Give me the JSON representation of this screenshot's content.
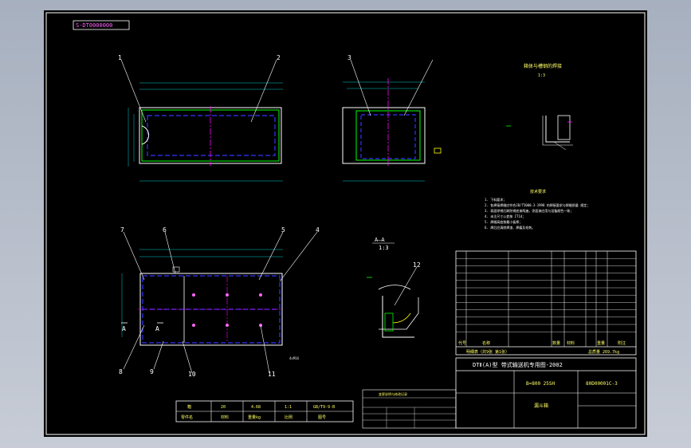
{
  "drawing": {
    "code_box": "S-DT0000000",
    "colors": {
      "sheet": "#000000",
      "outline": "#ffffff",
      "part": "#00ff00",
      "hidden": "#3333ff",
      "dim": "#00cccc",
      "center": "#ff00ff",
      "text": "#ffff00"
    }
  },
  "callouts": [
    "1",
    "2",
    "3",
    "4",
    "5",
    "6",
    "7",
    "8",
    "9",
    "10",
    "11",
    "12"
  ],
  "views": {
    "detail_title": "箱体与槽钢的焊接",
    "detail_scale": "1:3",
    "section_title": "A—A",
    "section_scale": "1:3",
    "section_marker": "A"
  },
  "tech_req": {
    "title": "技术要求",
    "lines": [
      "1. 下料要求；",
      "2. 各焊接焊缝应符合JB/T5000.3-1998 的焊接要求与焊缝质量 规定；",
      "3. 表面除锈后刷防锈底漆两遍，涂面漆应用与设备颜色一致；",
      "4. 未注尺寸公差按 IT14；",
      "5. 焊缝高度按最小板厚；",
      "6. 焊后应清除焊渣、焊瘤及毛刺。"
    ]
  },
  "bom": {
    "header": {
      "no": "代号",
      "name": "名称",
      "qty": "数量",
      "material": "材料",
      "weight": "重量",
      "remark": "附注"
    },
    "footer_left": "明细表（共9张 第1张）",
    "footer_right": "总质量 269.7kg"
  },
  "title_block": {
    "title": "DTⅡ(A)型 带式输送机专用图-2002",
    "model": "B=800 25SH",
    "drawing_no": "80D00001C-3",
    "part_name": "漏斗箱"
  },
  "small_table": {
    "row1": [
      "箱",
      "20",
      "4.68",
      "1:1",
      "GB/T9-9-B"
    ],
    "row2": [
      "零件名",
      "材料",
      "重量kg",
      "比例",
      "图号"
    ]
  },
  "revision_note": "变更说明与修改记录"
}
